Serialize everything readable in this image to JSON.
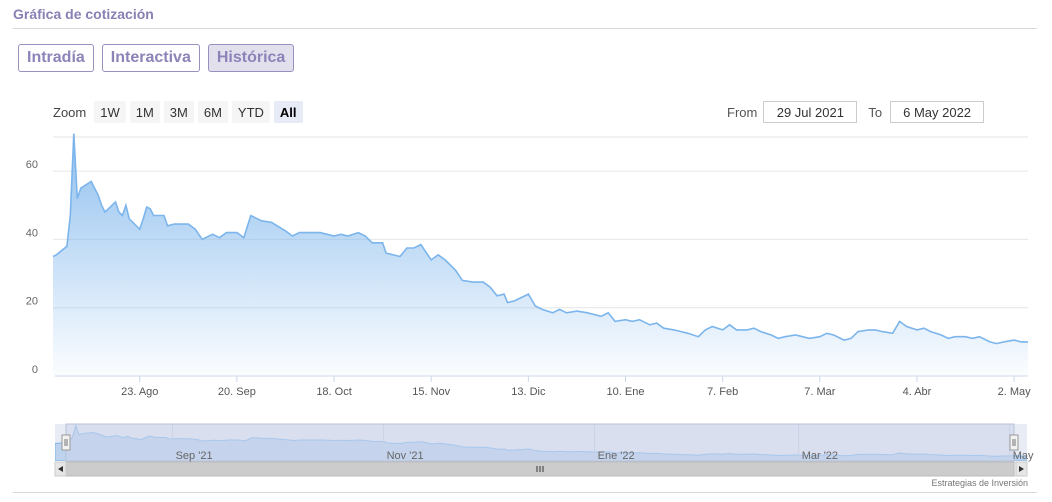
{
  "header": {
    "title": "Gráfica de cotización"
  },
  "tabs": [
    {
      "label": "Intradía",
      "active": false
    },
    {
      "label": "Interactiva",
      "active": false
    },
    {
      "label": "Histórica",
      "active": true
    }
  ],
  "zoom": {
    "label": "Zoom",
    "buttons": [
      "1W",
      "1M",
      "3M",
      "6M",
      "YTD",
      "All"
    ],
    "active": "All"
  },
  "range": {
    "from_label": "From",
    "from_value": "29 Jul 2021",
    "to_label": "To",
    "to_value": "6 May 2022"
  },
  "credit": "Estrategias de Inversión",
  "colors": {
    "line": "#7cb5ec",
    "accent": "#8a7fb3",
    "navigator_mask": "#ccd6eb"
  },
  "chart_data": {
    "type": "area",
    "x_start": "2021-07-29",
    "x_end": "2022-05-06",
    "ylim": [
      0,
      70
    ],
    "y_ticks": [
      0,
      20,
      40,
      60
    ],
    "x_ticks": [
      {
        "date": "2021-08-23",
        "label": "23. Ago"
      },
      {
        "date": "2021-09-20",
        "label": "20. Sep"
      },
      {
        "date": "2021-10-18",
        "label": "18. Oct"
      },
      {
        "date": "2021-11-15",
        "label": "15. Nov"
      },
      {
        "date": "2021-12-13",
        "label": "13. Dic"
      },
      {
        "date": "2022-01-10",
        "label": "10. Ene"
      },
      {
        "date": "2022-02-07",
        "label": "7. Feb"
      },
      {
        "date": "2022-03-07",
        "label": "7. Mar"
      },
      {
        "date": "2022-04-04",
        "label": "4. Abr"
      },
      {
        "date": "2022-05-02",
        "label": "2. May"
      }
    ],
    "navigator_ticks": [
      {
        "date": "2021-09-01",
        "label": "Sep '21"
      },
      {
        "date": "2021-11-01",
        "label": "Nov '21"
      },
      {
        "date": "2022-01-01",
        "label": "Ene '22"
      },
      {
        "date": "2022-03-01",
        "label": "Mar '22"
      },
      {
        "date": "2022-05-01",
        "label": "May"
      }
    ],
    "grid": true,
    "series": [
      {
        "points": [
          [
            "2021-07-29",
            35
          ],
          [
            "2021-07-30",
            35.5
          ],
          [
            "2021-08-02",
            38
          ],
          [
            "2021-08-03",
            47
          ],
          [
            "2021-08-04",
            71
          ],
          [
            "2021-08-05",
            52
          ],
          [
            "2021-08-06",
            55
          ],
          [
            "2021-08-09",
            57
          ],
          [
            "2021-08-10",
            55
          ],
          [
            "2021-08-11",
            53
          ],
          [
            "2021-08-12",
            50
          ],
          [
            "2021-08-13",
            48
          ],
          [
            "2021-08-16",
            51
          ],
          [
            "2021-08-17",
            48
          ],
          [
            "2021-08-18",
            47
          ],
          [
            "2021-08-19",
            50
          ],
          [
            "2021-08-20",
            46
          ],
          [
            "2021-08-23",
            43
          ],
          [
            "2021-08-24",
            46
          ],
          [
            "2021-08-25",
            49.5
          ],
          [
            "2021-08-26",
            49
          ],
          [
            "2021-08-27",
            47
          ],
          [
            "2021-08-30",
            47
          ],
          [
            "2021-08-31",
            44
          ],
          [
            "2021-09-02",
            44.5
          ],
          [
            "2021-09-06",
            44.5
          ],
          [
            "2021-09-08",
            43
          ],
          [
            "2021-09-10",
            40
          ],
          [
            "2021-09-13",
            41.5
          ],
          [
            "2021-09-15",
            40.5
          ],
          [
            "2021-09-17",
            42
          ],
          [
            "2021-09-20",
            42
          ],
          [
            "2021-09-22",
            40.5
          ],
          [
            "2021-09-24",
            47
          ],
          [
            "2021-09-27",
            45.5
          ],
          [
            "2021-09-30",
            45
          ],
          [
            "2021-10-04",
            42.5
          ],
          [
            "2021-10-06",
            41
          ],
          [
            "2021-10-08",
            42
          ],
          [
            "2021-10-12",
            42
          ],
          [
            "2021-10-14",
            42
          ],
          [
            "2021-10-18",
            41
          ],
          [
            "2021-10-20",
            41.5
          ],
          [
            "2021-10-22",
            41
          ],
          [
            "2021-10-25",
            42
          ],
          [
            "2021-10-27",
            41
          ],
          [
            "2021-10-29",
            39
          ],
          [
            "2021-11-01",
            39
          ],
          [
            "2021-11-02",
            36
          ],
          [
            "2021-11-04",
            35.5
          ],
          [
            "2021-11-06",
            35
          ],
          [
            "2021-11-08",
            37.5
          ],
          [
            "2021-11-10",
            37.5
          ],
          [
            "2021-11-12",
            38.5
          ],
          [
            "2021-11-15",
            34
          ],
          [
            "2021-11-17",
            35.5
          ],
          [
            "2021-11-19",
            34
          ],
          [
            "2021-11-22",
            31
          ],
          [
            "2021-11-24",
            28
          ],
          [
            "2021-11-27",
            27.5
          ],
          [
            "2021-11-30",
            27.5
          ],
          [
            "2021-12-02",
            26
          ],
          [
            "2021-12-04",
            23.5
          ],
          [
            "2021-12-06",
            24
          ],
          [
            "2021-12-07",
            21.5
          ],
          [
            "2021-12-09",
            22
          ],
          [
            "2021-12-13",
            24
          ],
          [
            "2021-12-15",
            20.5
          ],
          [
            "2021-12-17",
            19.5
          ],
          [
            "2021-12-20",
            18.5
          ],
          [
            "2021-12-22",
            19.5
          ],
          [
            "2021-12-24",
            18.5
          ],
          [
            "2021-12-27",
            19
          ],
          [
            "2021-12-30",
            18.5
          ],
          [
            "2022-01-03",
            17.5
          ],
          [
            "2022-01-05",
            18.5
          ],
          [
            "2022-01-07",
            16
          ],
          [
            "2022-01-10",
            16.5
          ],
          [
            "2022-01-12",
            16
          ],
          [
            "2022-01-14",
            16.5
          ],
          [
            "2022-01-17",
            15
          ],
          [
            "2022-01-19",
            15.5
          ],
          [
            "2022-01-21",
            14
          ],
          [
            "2022-01-24",
            13.5
          ],
          [
            "2022-01-26",
            13
          ],
          [
            "2022-01-28",
            12.5
          ],
          [
            "2022-01-31",
            11.5
          ],
          [
            "2022-02-02",
            13.5
          ],
          [
            "2022-02-04",
            14.5
          ],
          [
            "2022-02-07",
            13.5
          ],
          [
            "2022-02-09",
            15
          ],
          [
            "2022-02-11",
            13.5
          ],
          [
            "2022-02-14",
            13.5
          ],
          [
            "2022-02-16",
            14
          ],
          [
            "2022-02-18",
            13
          ],
          [
            "2022-02-21",
            12
          ],
          [
            "2022-02-23",
            11
          ],
          [
            "2022-02-25",
            11.5
          ],
          [
            "2022-02-28",
            12
          ],
          [
            "2022-03-02",
            11.5
          ],
          [
            "2022-03-04",
            11
          ],
          [
            "2022-03-07",
            11.5
          ],
          [
            "2022-03-09",
            12.5
          ],
          [
            "2022-03-11",
            12
          ],
          [
            "2022-03-14",
            10.5
          ],
          [
            "2022-03-16",
            11
          ],
          [
            "2022-03-18",
            13
          ],
          [
            "2022-03-21",
            13.5
          ],
          [
            "2022-03-23",
            13.5
          ],
          [
            "2022-03-25",
            13
          ],
          [
            "2022-03-28",
            12.5
          ],
          [
            "2022-03-30",
            16
          ],
          [
            "2022-04-01",
            14.5
          ],
          [
            "2022-04-04",
            13.5
          ],
          [
            "2022-04-06",
            14
          ],
          [
            "2022-04-08",
            13
          ],
          [
            "2022-04-11",
            12
          ],
          [
            "2022-04-13",
            11
          ],
          [
            "2022-04-15",
            11.5
          ],
          [
            "2022-04-18",
            11.5
          ],
          [
            "2022-04-20",
            11
          ],
          [
            "2022-04-22",
            11.5
          ],
          [
            "2022-04-25",
            10
          ],
          [
            "2022-04-27",
            9.5
          ],
          [
            "2022-04-29",
            10
          ],
          [
            "2022-05-02",
            10.5
          ],
          [
            "2022-05-04",
            10
          ],
          [
            "2022-05-06",
            10
          ]
        ]
      }
    ]
  }
}
